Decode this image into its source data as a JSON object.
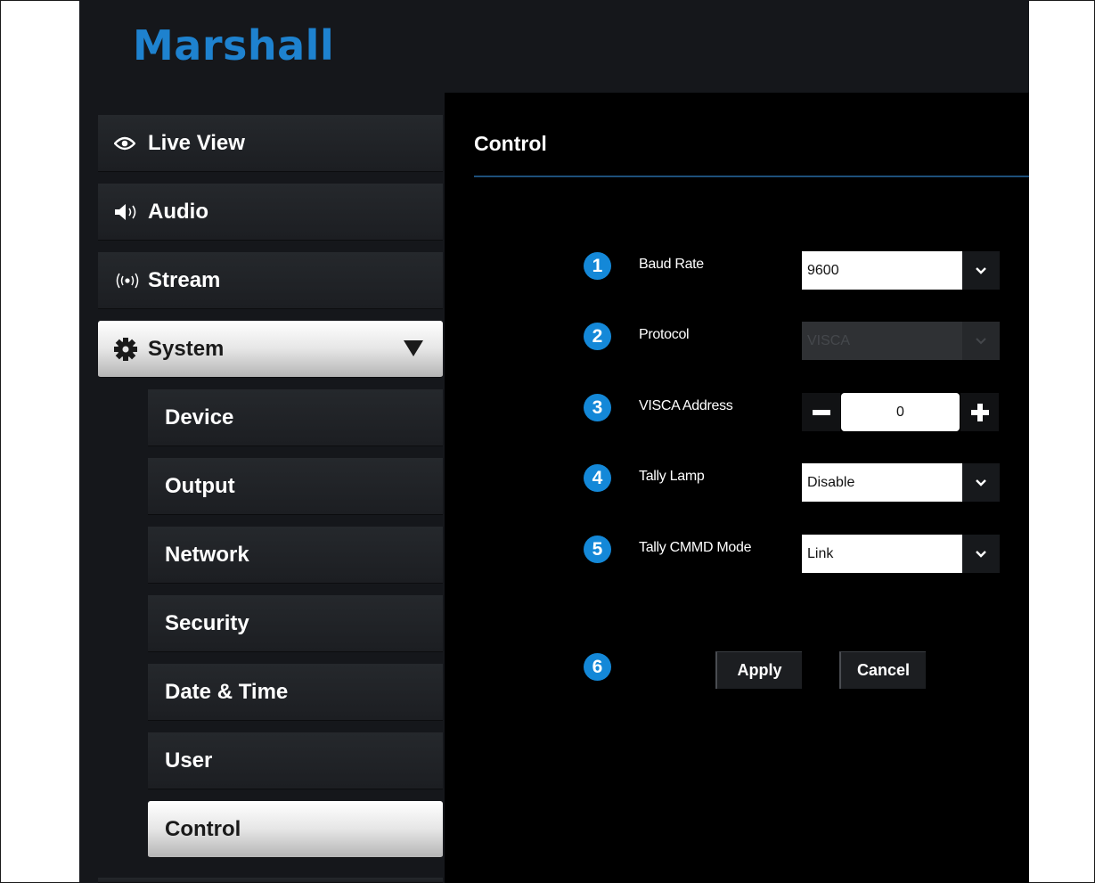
{
  "brand": {
    "logo": "Marshall"
  },
  "sidebar": {
    "items": [
      {
        "label": "Live View",
        "icon": "eye-icon"
      },
      {
        "label": "Audio",
        "icon": "speaker-icon"
      },
      {
        "label": "Stream",
        "icon": "broadcast-icon"
      },
      {
        "label": "System",
        "icon": "gear-icon",
        "expanded": true
      }
    ],
    "sub_items": [
      {
        "label": "Device"
      },
      {
        "label": "Output"
      },
      {
        "label": "Network"
      },
      {
        "label": "Security"
      },
      {
        "label": "Date & Time"
      },
      {
        "label": "User"
      },
      {
        "label": "Control",
        "active": true
      }
    ]
  },
  "main": {
    "title": "Control",
    "fields": {
      "baud_rate": {
        "badge": "1",
        "label": "Baud Rate",
        "value": "9600"
      },
      "protocol": {
        "badge": "2",
        "label": "Protocol",
        "value": "VISCA",
        "disabled": true
      },
      "visca_address": {
        "badge": "3",
        "label": "VISCA Address",
        "value": "0"
      },
      "tally_lamp": {
        "badge": "4",
        "label": "Tally Lamp",
        "value": "Disable"
      },
      "tally_cmmd_mode": {
        "badge": "5",
        "label": "Tally CMMD Mode",
        "value": "Link"
      }
    },
    "actions": {
      "badge": "6",
      "apply_label": "Apply",
      "cancel_label": "Cancel"
    }
  },
  "colors": {
    "brand_blue": "#1e82cf",
    "badge_blue": "#1488d8",
    "background": "#15171b",
    "content_background": "#000000"
  }
}
